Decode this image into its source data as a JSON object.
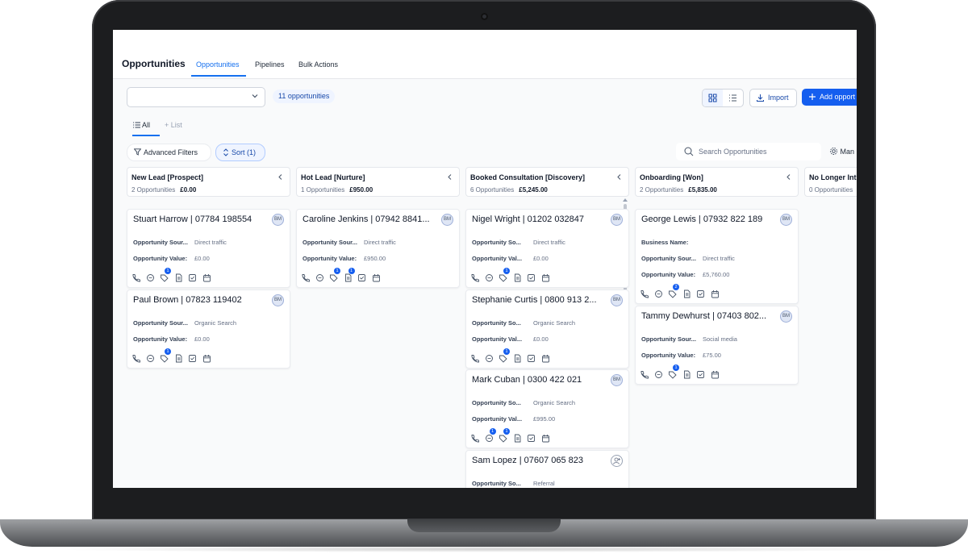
{
  "header": {
    "title": "Opportunities",
    "tabs": [
      {
        "label": "Opportunities",
        "active": true
      },
      {
        "label": "Pipelines",
        "active": false
      },
      {
        "label": "Bulk Actions",
        "active": false
      }
    ]
  },
  "toolbar": {
    "pipeline_value": "",
    "count_label": "11 opportunities",
    "import_label": "Import",
    "add_label": "Add opport",
    "views": [
      {
        "label": "All",
        "active": true
      },
      {
        "label": "List",
        "active": false
      }
    ],
    "advanced_filters_label": "Advanced Filters",
    "sort_label": "Sort (1)",
    "search_placeholder": "Search Opportunities",
    "manage_label": "Man"
  },
  "colors": {
    "accent": "#155eef",
    "accent_soft": "#eff4ff",
    "badge": "#155eef"
  },
  "columns": [
    {
      "name": "New Lead [Prospect]",
      "count": "2 Opportunities",
      "total": "£0.00",
      "cards": [
        {
          "title": "Stuart Harrow | 07784 198554",
          "avatar": "BM",
          "fields": [
            {
              "label": "Opportunity Sour...",
              "value": "Direct traffic"
            },
            {
              "label": "Opportunity Value:",
              "value": "£0.00"
            }
          ],
          "badges": {
            "tasks": "1"
          }
        },
        {
          "title": "Paul Brown | 07823 119402",
          "avatar": "BM",
          "fields": [
            {
              "label": "Opportunity Sour...",
              "value": "Organic Search"
            },
            {
              "label": "Opportunity Value:",
              "value": "£0.00"
            }
          ],
          "badges": {
            "tasks": "1"
          }
        }
      ]
    },
    {
      "name": "Hot Lead [Nurture]",
      "count": "1 Opportunities",
      "total": "£950.00",
      "cards": [
        {
          "title": "Caroline Jenkins | 07942 8841...",
          "avatar": "BM",
          "fields": [
            {
              "label": "Opportunity Sour...",
              "value": "Direct traffic"
            },
            {
              "label": "Opportunity Value:",
              "value": "£950.00"
            }
          ],
          "badges": {
            "tasks": "1",
            "notes": "1"
          }
        }
      ]
    },
    {
      "name": "Booked Consultation [Discovery]",
      "count": "6 Opportunities",
      "total": "£5,245.00",
      "cards": [
        {
          "title": "Nigel Wright | 01202 032847",
          "avatar": "BM",
          "fields": [
            {
              "label": "Opportunity So...",
              "value": "Direct traffic"
            },
            {
              "label": "Opportunity Val...",
              "value": "£0.00"
            }
          ],
          "badges": {
            "tasks": "1"
          }
        },
        {
          "title": "Stephanie Curtis | 0800 913 2...",
          "avatar": "BM",
          "fields": [
            {
              "label": "Opportunity So...",
              "value": "Organic Search"
            },
            {
              "label": "Opportunity Val...",
              "value": "£0.00"
            }
          ],
          "badges": {
            "tasks": "1"
          }
        },
        {
          "title": "Mark Cuban | 0300 422 021",
          "avatar": "BM",
          "fields": [
            {
              "label": "Opportunity So...",
              "value": "Organic Search"
            },
            {
              "label": "Opportunity Val...",
              "value": "£995.00"
            }
          ],
          "badges": {
            "messages": "1",
            "tasks": "1"
          }
        },
        {
          "title": "Sam Lopez | 07607 065 823",
          "avatar": "",
          "fields": [
            {
              "label": "Opportunity So...",
              "value": "Referral"
            }
          ],
          "badges": {}
        }
      ]
    },
    {
      "name": "Onboarding [Won]",
      "count": "2 Opportunities",
      "total": "£5,835.00",
      "cards": [
        {
          "title": "George Lewis | 07932 822 189",
          "avatar": "BM",
          "fields": [
            {
              "label": "Business Name:",
              "value": ""
            },
            {
              "label": "Opportunity Sour...",
              "value": "Direct traffic"
            },
            {
              "label": "Opportunity Value:",
              "value": "£5,760.00"
            }
          ],
          "badges": {
            "tasks": "2"
          }
        },
        {
          "title": "Tammy Dewhurst | 07403 802...",
          "avatar": "BM",
          "fields": [
            {
              "label": "Opportunity Sour...",
              "value": "Social media"
            },
            {
              "label": "Opportunity Value:",
              "value": "£75.00"
            }
          ],
          "badges": {
            "tasks": "1"
          }
        }
      ]
    },
    {
      "name": "No Longer Int",
      "count": "0 Opportunities",
      "total": "",
      "cards": []
    }
  ]
}
